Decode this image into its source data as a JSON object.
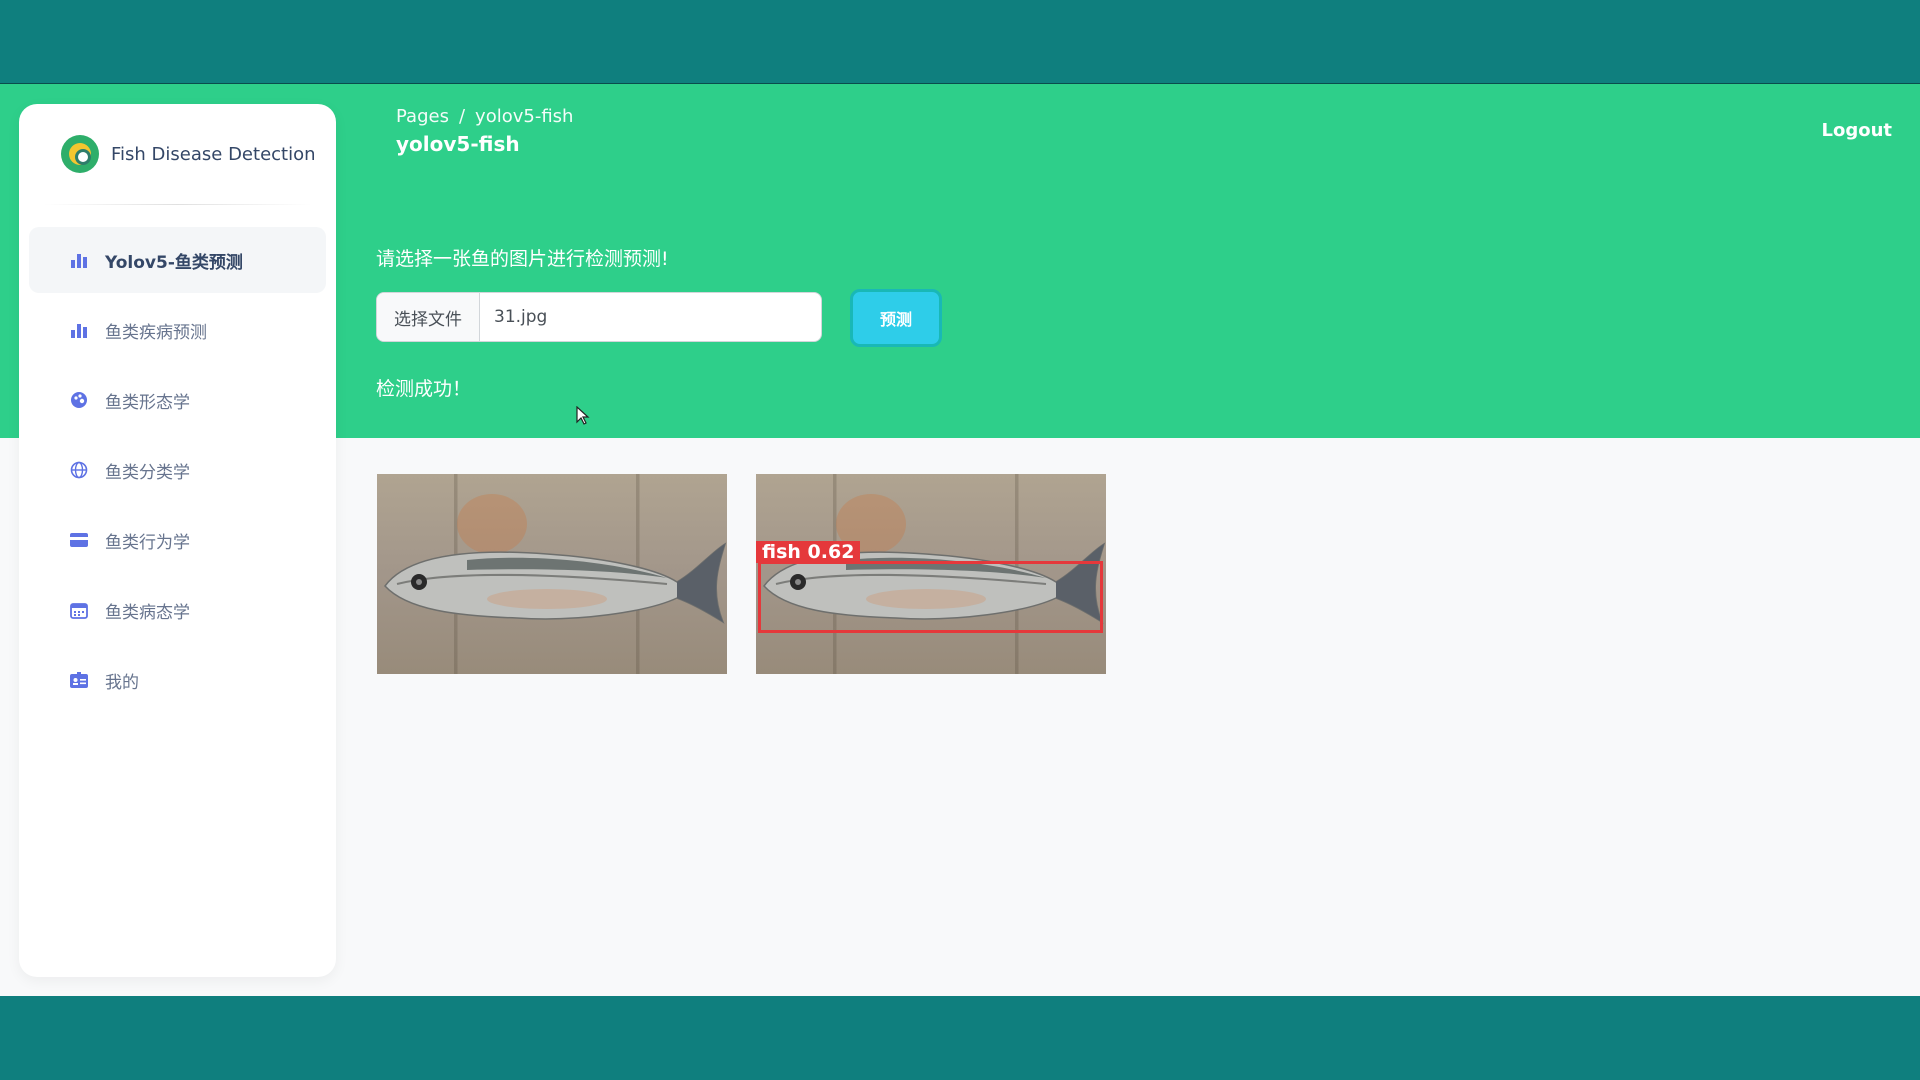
{
  "brand": {
    "name": "Fish Disease Detection"
  },
  "sidebar": {
    "items": [
      {
        "label": "Yolov5-鱼类预测",
        "icon": "bar-chart-icon",
        "active": true
      },
      {
        "label": "鱼类疾病预测",
        "icon": "bar-chart-icon",
        "active": false
      },
      {
        "label": "鱼类形态学",
        "icon": "palette-icon",
        "active": false
      },
      {
        "label": "鱼类分类学",
        "icon": "globe-icon",
        "active": false
      },
      {
        "label": "鱼类行为学",
        "icon": "credit-card-icon",
        "active": false
      },
      {
        "label": "鱼类病态学",
        "icon": "calendar-icon",
        "active": false
      },
      {
        "label": "我的",
        "icon": "id-card-icon",
        "active": false
      }
    ]
  },
  "header": {
    "breadcrumb": {
      "root": "Pages",
      "separator": "/",
      "current": "yolov5-fish"
    },
    "title": "yolov5-fish",
    "logout_label": "Logout"
  },
  "form": {
    "instruction": "请选择一张鱼的图片进行检测预测!",
    "file_button_label": "选择文件",
    "file_name": "31.jpg",
    "predict_label": "预测",
    "status": "检测成功！"
  },
  "results": {
    "detection_label": "fish  0.62"
  },
  "colors": {
    "header_green": "#2ecf8a",
    "frame_teal": "#0f7f7e",
    "predict_button": "#2ecde9",
    "detection_box": "#e5383b",
    "icon_accent": "#5e72e4"
  }
}
